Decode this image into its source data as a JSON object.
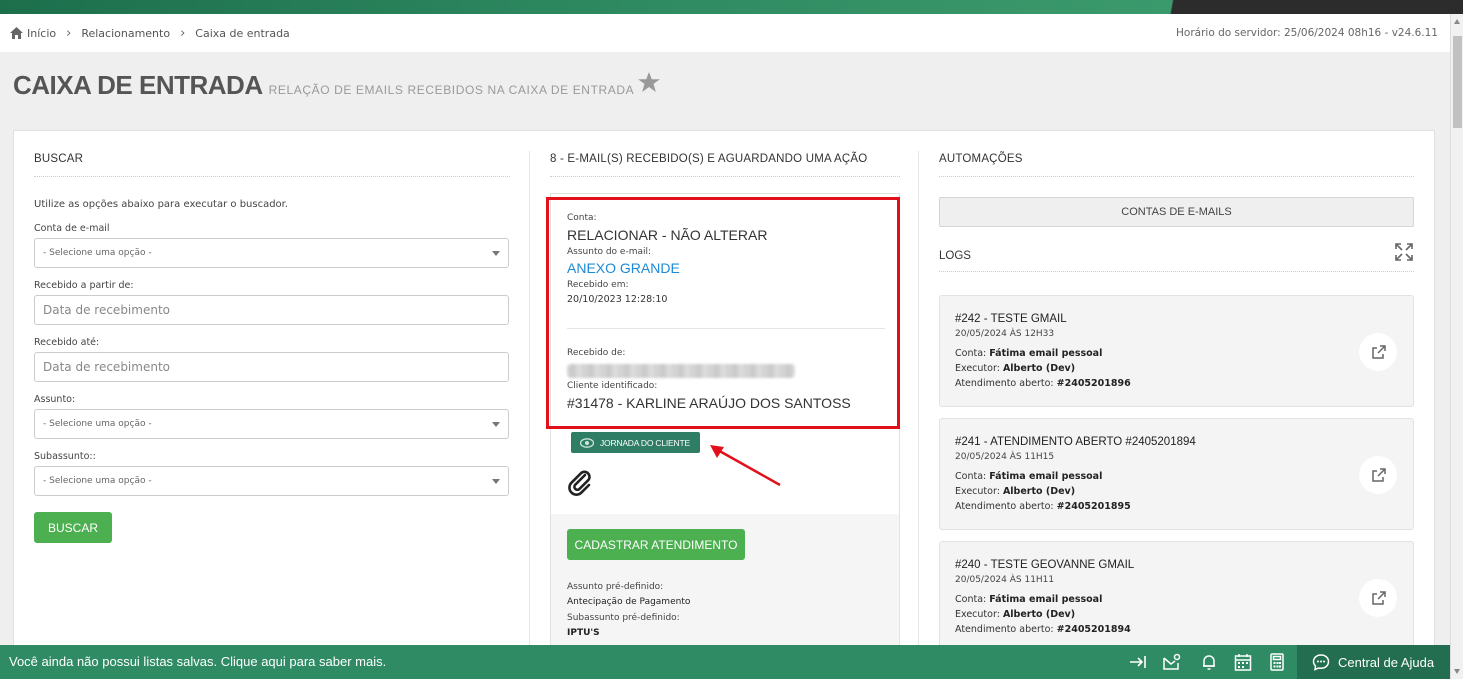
{
  "breadcrumb": {
    "home": "Início",
    "items": [
      "Relacionamento",
      "Caixa de entrada"
    ]
  },
  "server_time": "Horário do servidor: 25/06/2024 08h16 - v24.6.11",
  "page": {
    "title": "CAIXA DE ENTRADA",
    "subtitle": "RELAÇÃO DE EMAILS RECEBIDOS NA CAIXA DE ENTRADA"
  },
  "search": {
    "title": "BUSCAR",
    "hint": "Utilize as opções abaixo para executar o buscador.",
    "account_label": "Conta de e-mail",
    "account_value": "- Selecione uma opção -",
    "from_label": "Recebido a partir de:",
    "from_placeholder": "Data de recebimento",
    "until_label": "Recebido até:",
    "until_placeholder": "Data de recebimento",
    "subject_label": "Assunto:",
    "subject_value": "- Selecione uma opção -",
    "subsubject_label": "Subassunto::",
    "subsubject_value": "- Selecione uma opção -",
    "button": "BUSCAR"
  },
  "mail": {
    "title": "8 - E-MAIL(S) RECEBIDO(S) E AGUARDANDO UMA AÇÃO",
    "account_label": "Conta:",
    "account_value": "RELACIONAR - NÃO ALTERAR",
    "subject_label": "Assunto do e-mail:",
    "subject_value": "ANEXO GRANDE",
    "received_label": "Recebido em:",
    "received_value": "20/10/2023 12:28:10",
    "from_label": "Recebido de:",
    "client_label": "Cliente identificado:",
    "client_value": "#31478 - KARLINE ARAÚJO DOS SANTOSS",
    "journey_button": "JORNADA DO CLIENTE",
    "register_button": "CADASTRAR ATENDIMENTO",
    "predef_subject_label": "Assunto pré-definido:",
    "predef_subject_value": "Antecipação de Pagamento",
    "predef_subsubject_label": "Subassunto pré-definido:",
    "predef_subsubject_value": "IPTU'S"
  },
  "automations": {
    "title": "AUTOMAÇÕES",
    "email_accounts_button": "CONTAS DE E-MAILS",
    "logs_title": "LOGS",
    "logs": [
      {
        "title": "#242 - TESTE GMAIL",
        "date": "20/05/2024 ÀS 12H33",
        "conta_label": "Conta:",
        "conta": "Fátima email pessoal",
        "executor_label": "Executor:",
        "executor": "Alberto (Dev)",
        "atendimento_label": "Atendimento aberto:",
        "atendimento": "#2405201896"
      },
      {
        "title": "#241 - ATENDIMENTO ABERTO #2405201894",
        "date": "20/05/2024 ÀS 11H15",
        "conta_label": "Conta:",
        "conta": "Fátima email pessoal",
        "executor_label": "Executor:",
        "executor": "Alberto (Dev)",
        "atendimento_label": "Atendimento aberto:",
        "atendimento": "#2405201895"
      },
      {
        "title": "#240 - TESTE GEOVANNE GMAIL",
        "date": "20/05/2024 ÀS 11H11",
        "conta_label": "Conta:",
        "conta": "Fátima email pessoal",
        "executor_label": "Executor:",
        "executor": "Alberto (Dev)",
        "atendimento_label": "Atendimento aberto:",
        "atendimento": "#2405201894"
      }
    ]
  },
  "footer": {
    "message": "Você ainda não possui listas salvas. Clique aqui para saber mais.",
    "help": "Central de Ajuda",
    "icons": [
      "exit-icon",
      "mail-settings-icon",
      "bell-icon",
      "calendar-icon",
      "calculator-icon",
      "chat-icon"
    ]
  },
  "colors": {
    "brand_green": "#2e8b64",
    "button_green": "#4caf50",
    "highlight_red": "#e2101a",
    "link_blue": "#1c8ad6"
  }
}
